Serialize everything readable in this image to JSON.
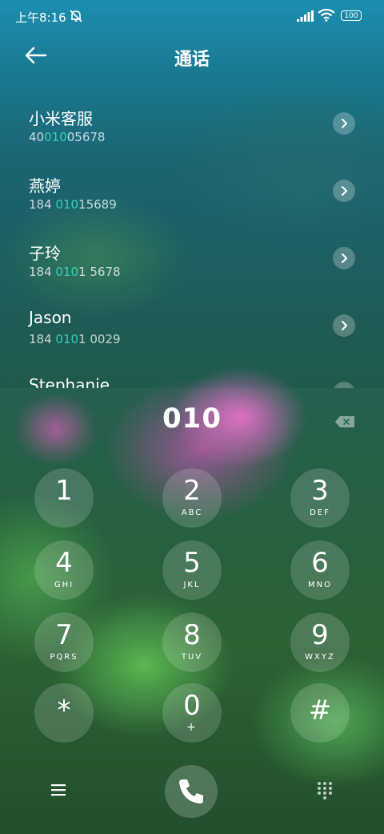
{
  "status_bar": {
    "time": "上午8:16",
    "battery": "100"
  },
  "header": {
    "title": "通话"
  },
  "contacts": [
    {
      "name": "小米客服",
      "num_pre": "40",
      "num_hl": "010",
      "num_post": "05678"
    },
    {
      "name": "燕婷",
      "num_pre": "184 ",
      "num_hl": "010",
      "num_post": "15689"
    },
    {
      "name": "子玲",
      "num_pre": "184 ",
      "num_hl": "010",
      "num_post": "1 5678"
    },
    {
      "name": "Jason",
      "num_pre": "184 ",
      "num_hl": "010",
      "num_post": "1 0029"
    },
    {
      "name": "Stephanie",
      "num_pre": "",
      "num_hl": "",
      "num_post": ""
    }
  ],
  "dialer": {
    "input": "010",
    "keys": [
      {
        "digit": "1",
        "letters": ""
      },
      {
        "digit": "2",
        "letters": "ABC"
      },
      {
        "digit": "3",
        "letters": "DEF"
      },
      {
        "digit": "4",
        "letters": "GHI"
      },
      {
        "digit": "5",
        "letters": "JKL"
      },
      {
        "digit": "6",
        "letters": "MNO"
      },
      {
        "digit": "7",
        "letters": "PQRS"
      },
      {
        "digit": "8",
        "letters": "TUV"
      },
      {
        "digit": "9",
        "letters": "WXYZ"
      },
      {
        "digit": "*",
        "letters": ""
      },
      {
        "digit": "0",
        "letters": "+"
      },
      {
        "digit": "#",
        "letters": ""
      }
    ]
  },
  "icons": {
    "back": "arrow-left-icon",
    "chevron": "chevron-right-icon",
    "backspace": "backspace-icon",
    "call": "phone-icon",
    "menu": "hamburger-icon",
    "keypad": "keypad-icon",
    "mute": "bell-off-icon",
    "signal": "signal-icon",
    "wifi": "wifi-icon"
  },
  "colors": {
    "highlight": "#35d0b4"
  }
}
